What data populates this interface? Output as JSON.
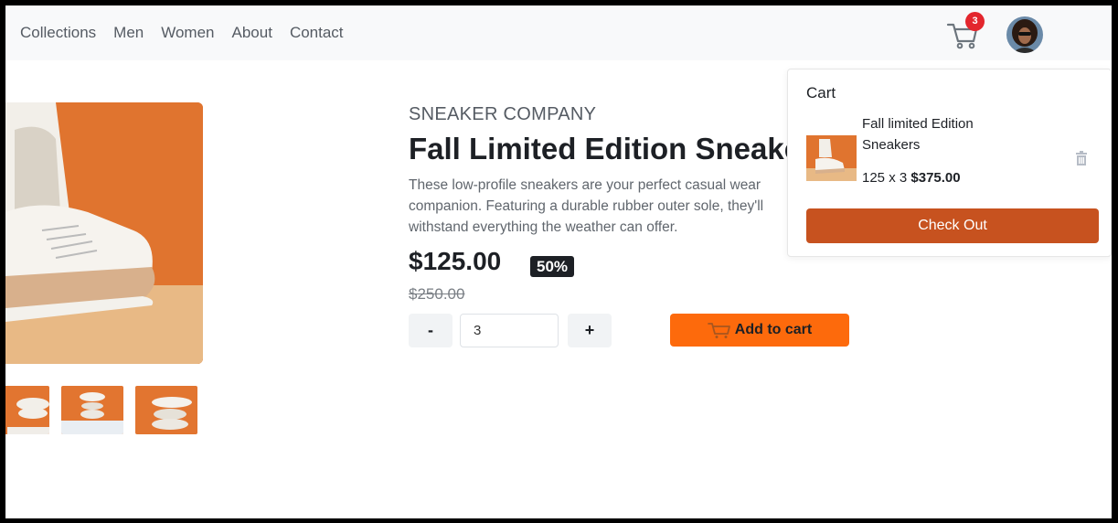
{
  "nav": {
    "links": [
      "Collections",
      "Men",
      "Women",
      "About",
      "Contact"
    ],
    "cart_count": "3"
  },
  "product": {
    "company": "SNEAKER COMPANY",
    "title": "Fall Limited Edition Sneakers",
    "description": "These low-profile sneakers are your perfect casual wear companion. Featuring a durable rubber outer sole, they'll withstand everything the weather can offer.",
    "price": "$125.00",
    "discount": "50%",
    "original_price": "$250.00",
    "quantity": "3",
    "minus_label": "-",
    "plus_label": "+",
    "add_to_cart_label": "Add to cart"
  },
  "cart": {
    "title": "Cart",
    "item_name": "Fall limited Edition Sneakers",
    "item_unit": "125 x 3",
    "item_total": "$375.00",
    "checkout_label": "Check Out"
  },
  "colors": {
    "accent_orange": "#fd6a0c",
    "checkout": "#c7521f",
    "badge_red": "#e3262d",
    "dark": "#1d2025"
  },
  "icons": [
    "cart-icon",
    "avatar-image",
    "trash-icon",
    "cart-icon-small"
  ]
}
